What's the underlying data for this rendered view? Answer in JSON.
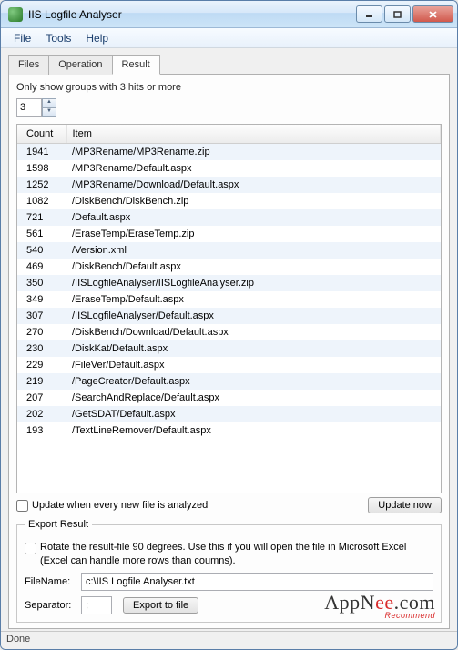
{
  "window": {
    "title": "IIS Logfile Analyser"
  },
  "menu": {
    "file": "File",
    "tools": "Tools",
    "help": "Help"
  },
  "tabs": {
    "files": "Files",
    "operation": "Operation",
    "result": "Result"
  },
  "result": {
    "hint": "Only show groups with 3 hits or more",
    "threshold": "3",
    "columns": {
      "count": "Count",
      "item": "Item"
    },
    "rows": [
      {
        "count": "1941",
        "item": "/MP3Rename/MP3Rename.zip"
      },
      {
        "count": "1598",
        "item": "/MP3Rename/Default.aspx"
      },
      {
        "count": "1252",
        "item": "/MP3Rename/Download/Default.aspx"
      },
      {
        "count": "1082",
        "item": "/DiskBench/DiskBench.zip"
      },
      {
        "count": "721",
        "item": "/Default.aspx"
      },
      {
        "count": "561",
        "item": "/EraseTemp/EraseTemp.zip"
      },
      {
        "count": "540",
        "item": "/Version.xml"
      },
      {
        "count": "469",
        "item": "/DiskBench/Default.aspx"
      },
      {
        "count": "350",
        "item": "/IISLogfileAnalyser/IISLogfileAnalyser.zip"
      },
      {
        "count": "349",
        "item": "/EraseTemp/Default.aspx"
      },
      {
        "count": "307",
        "item": "/IISLogfileAnalyser/Default.aspx"
      },
      {
        "count": "270",
        "item": "/DiskBench/Download/Default.aspx"
      },
      {
        "count": "230",
        "item": "/DiskKat/Default.aspx"
      },
      {
        "count": "229",
        "item": "/FileVer/Default.aspx"
      },
      {
        "count": "219",
        "item": "/PageCreator/Default.aspx"
      },
      {
        "count": "207",
        "item": "/SearchAndReplace/Default.aspx"
      },
      {
        "count": "202",
        "item": "/GetSDAT/Default.aspx"
      },
      {
        "count": "193",
        "item": "/TextLineRemover/Default.aspx"
      }
    ],
    "update_checkbox_label": "Update when every new file is analyzed",
    "update_now": "Update now"
  },
  "export": {
    "legend": "Export Result",
    "rotate_label": "Rotate the result-file 90 degrees. Use this if you will open the file in Microsoft Excel (Excel can handle more rows than coumns).",
    "filename_label": "FileName:",
    "filename_value": "c:\\IIS Logfile Analyser.txt",
    "separator_label": "Separator:",
    "separator_value": ";",
    "export_btn": "Export to file"
  },
  "status": "Done",
  "watermark": {
    "brand_prefix": "AppN",
    "brand_oo": "ee",
    "brand_suffix": ".com",
    "tag": "Recommend"
  }
}
